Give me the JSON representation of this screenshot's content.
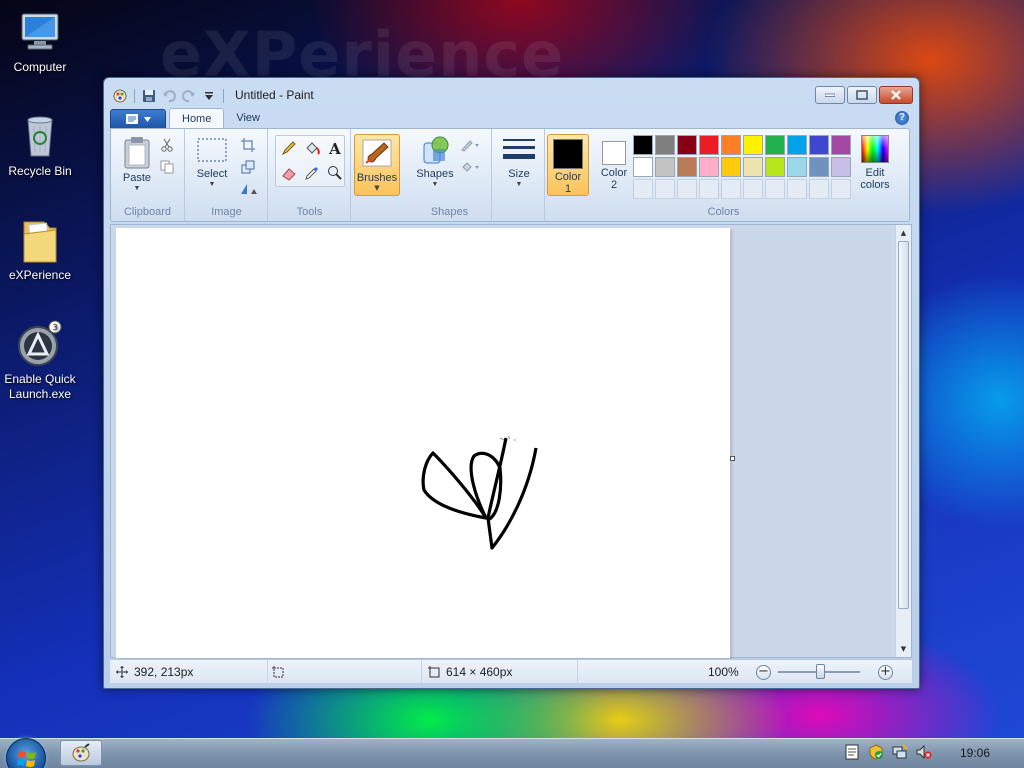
{
  "desktop": {
    "watermark": "eXPerience",
    "icons": [
      {
        "label": "Computer",
        "icon": "computer-icon"
      },
      {
        "label": "Recycle Bin",
        "icon": "recycle-bin-icon"
      },
      {
        "label": "eXPerience",
        "icon": "folder-icon"
      },
      {
        "label": "Enable Quick Launch.exe",
        "icon": "quick-launch-icon"
      }
    ]
  },
  "window": {
    "title": "Untitled - Paint",
    "tabs": [
      {
        "label": "Home",
        "active": true
      },
      {
        "label": "View",
        "active": false
      }
    ],
    "help_label": "?"
  },
  "ribbon": {
    "clipboard": {
      "group_label": "Clipboard",
      "paste_label": "Paste"
    },
    "image": {
      "group_label": "Image",
      "select_label": "Select"
    },
    "tools": {
      "group_label": "Tools"
    },
    "brushes": {
      "label": "Brushes"
    },
    "shapes": {
      "group_label": "Shapes",
      "shapes_label": "Shapes"
    },
    "size": {
      "label": "Size"
    },
    "colors": {
      "group_label": "Colors",
      "color1_label_line1": "Color",
      "color1_label_line2": "1",
      "color2_label_line1": "Color",
      "color2_label_line2": "2",
      "color1_value": "#000000",
      "color2_value": "#ffffff",
      "edit_label_line1": "Edit",
      "edit_label_line2": "colors",
      "palette_row1": [
        "#000000",
        "#7f7f7f",
        "#880015",
        "#ed1c24",
        "#ff7f27",
        "#fff200",
        "#22b14c",
        "#00a2e8",
        "#3f48cc",
        "#a349a4"
      ],
      "palette_row2": [
        "#ffffff",
        "#c3c3c3",
        "#b97a57",
        "#ffaec9",
        "#ffc90e",
        "#efe4b0",
        "#b5e61d",
        "#99d9ea",
        "#7092be",
        "#c8bfe7"
      ]
    }
  },
  "statusbar": {
    "cursor_position": "392, 213px",
    "canvas_size": "614 × 460px",
    "zoom": "100%",
    "zoom_minus": "−",
    "zoom_plus": "+"
  },
  "taskbar": {
    "clock": "19:06",
    "tray_icons": [
      "action-center-icon",
      "security-icon",
      "network-icon",
      "volume-muted-icon"
    ]
  }
}
